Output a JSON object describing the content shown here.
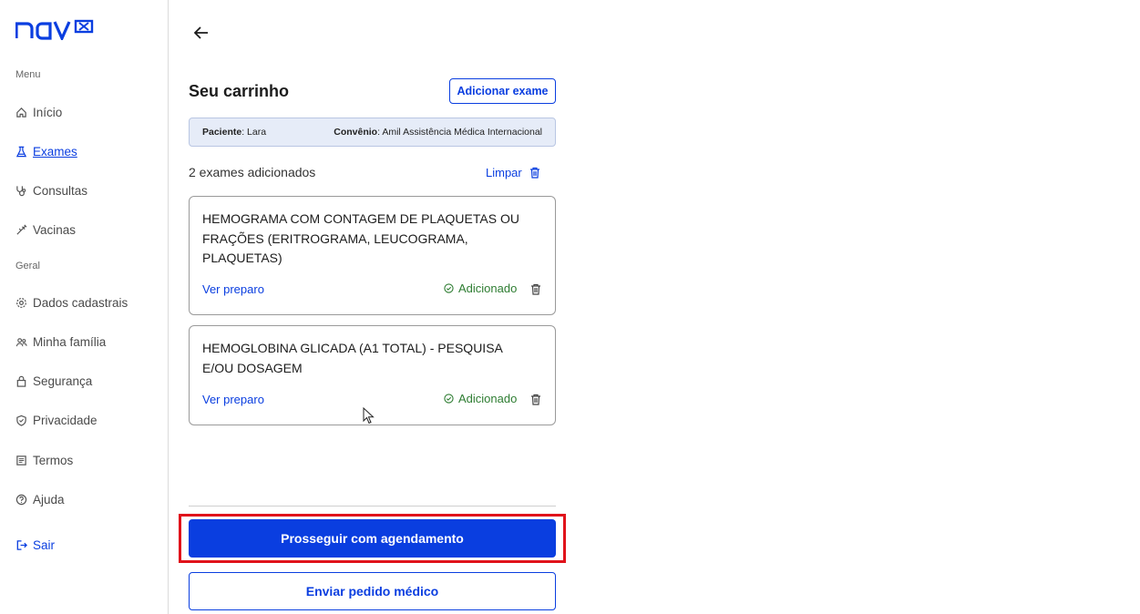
{
  "brand": {
    "logo_text": "nav"
  },
  "sidebar": {
    "menu_label": "Menu",
    "general_label": "Geral",
    "items": [
      {
        "label": "Início",
        "icon": "home-icon"
      },
      {
        "label": "Exames",
        "icon": "flask-icon",
        "active": true
      },
      {
        "label": "Consultas",
        "icon": "stethoscope-icon"
      },
      {
        "label": "Vacinas",
        "icon": "syringe-icon"
      }
    ],
    "general_items": [
      {
        "label": "Dados cadastrais",
        "icon": "gear-icon"
      },
      {
        "label": "Minha família",
        "icon": "family-icon"
      },
      {
        "label": "Segurança",
        "icon": "lock-icon"
      },
      {
        "label": "Privacidade",
        "icon": "shield-icon"
      },
      {
        "label": "Termos",
        "icon": "document-icon"
      },
      {
        "label": "Ajuda",
        "icon": "help-icon"
      }
    ],
    "logout_label": "Sair"
  },
  "cart": {
    "title": "Seu carrinho",
    "add_button": "Adicionar exame",
    "patient_label": "Paciente",
    "patient_value": ": Lara",
    "plan_label": "Convênio",
    "plan_value": ": Amil Assistência Médica Internacional",
    "count_text": "2 exames adicionados",
    "clear_label": "Limpar",
    "items": [
      {
        "name": "HEMOGRAMA COM CONTAGEM DE PLAQUETAS OU FRAÇÕES (ERITROGRAMA, LEUCOGRAMA, PLAQUETAS)",
        "prep_label": "Ver preparo",
        "status": "Adicionado"
      },
      {
        "name": "HEMOGLOBINA GLICADA (A1 TOTAL) - PESQUISA E/OU DOSAGEM",
        "prep_label": "Ver preparo",
        "status": "Adicionado"
      }
    ],
    "primary_button": "Prosseguir com agendamento",
    "secondary_button": "Enviar pedido médico"
  },
  "colors": {
    "brand_blue": "#0a3ee0",
    "success_green": "#2e7d32",
    "highlight_red": "#e0131b"
  }
}
